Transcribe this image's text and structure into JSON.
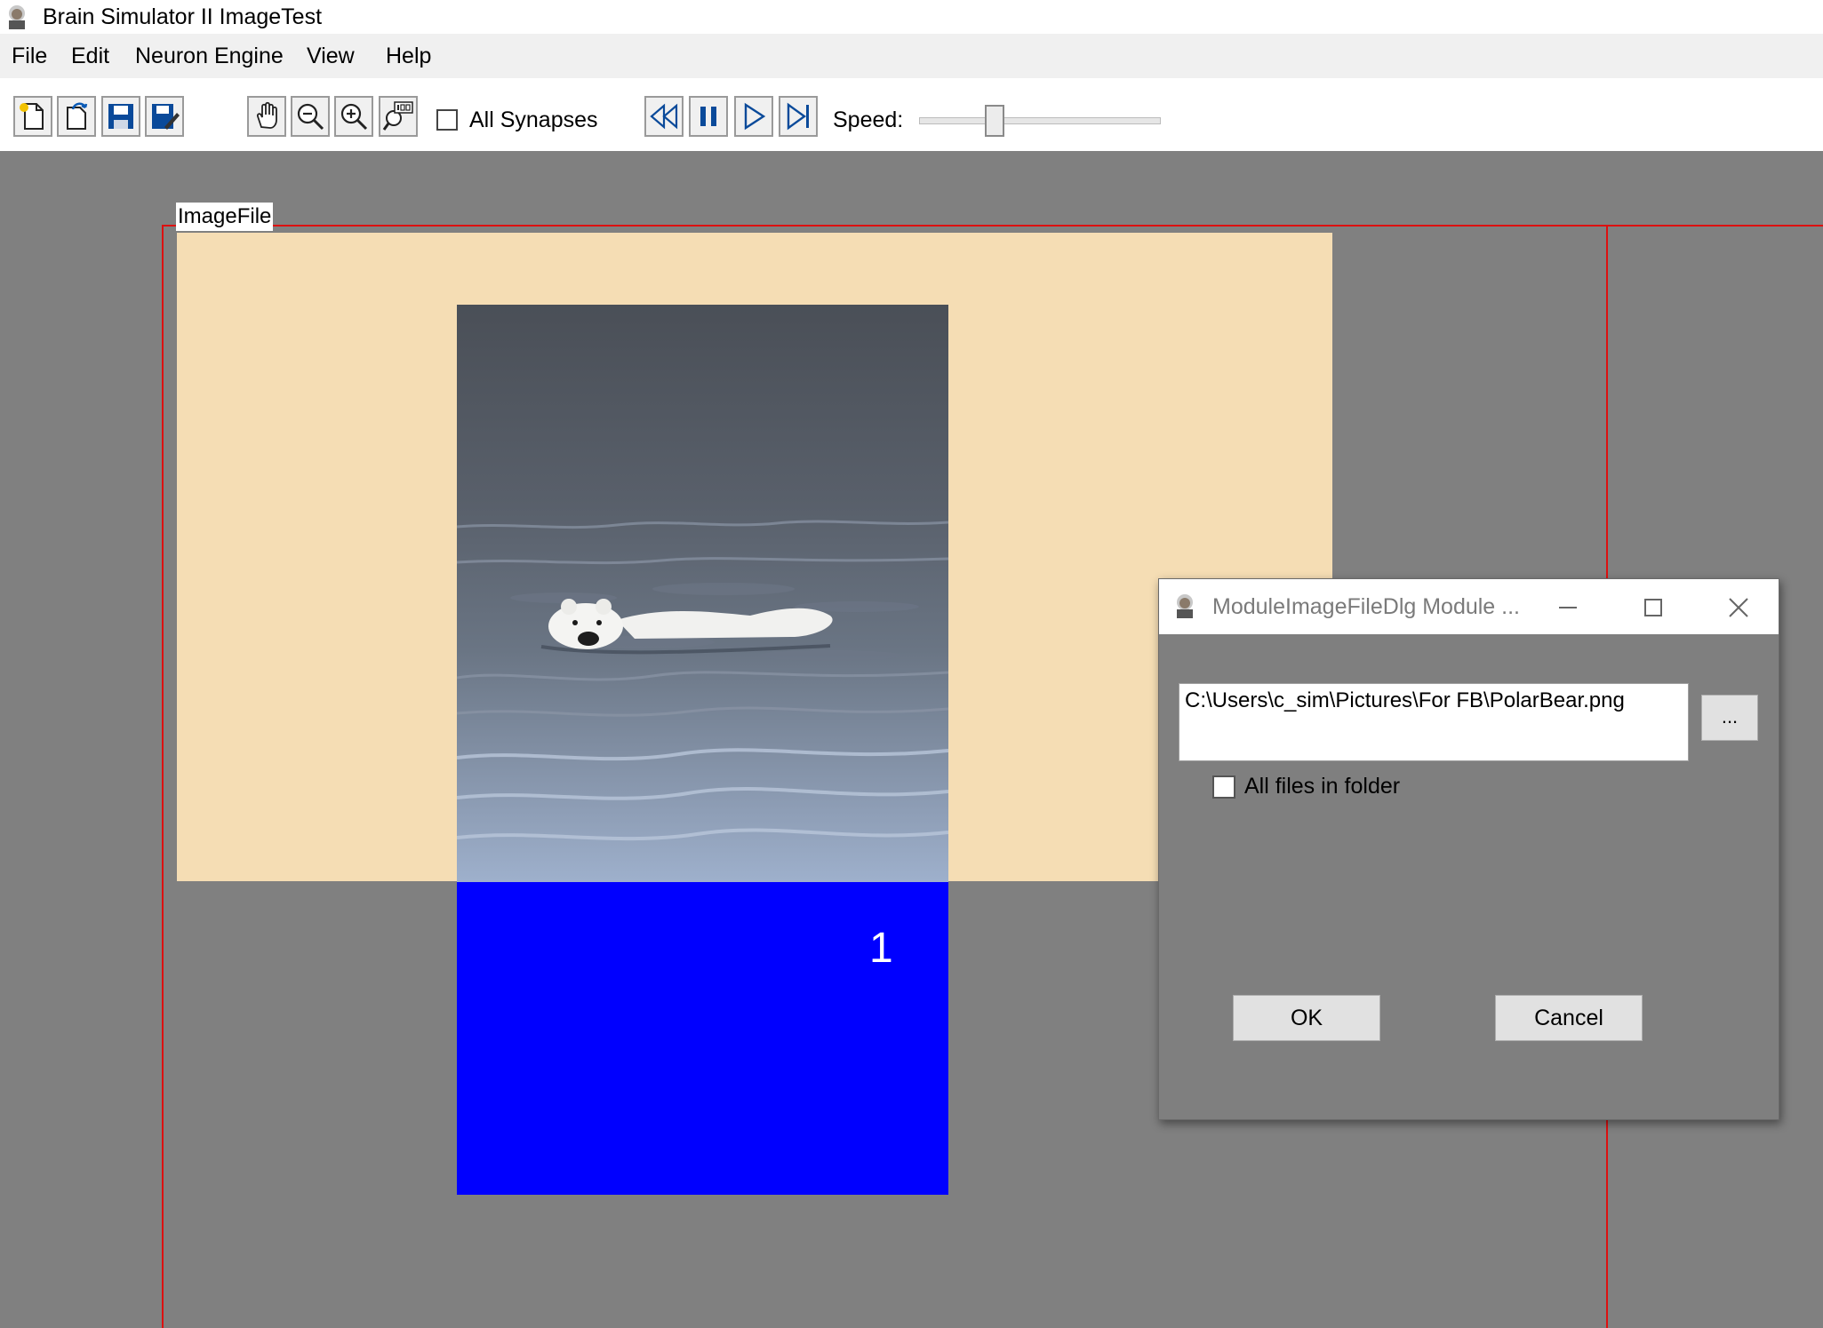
{
  "window": {
    "title": "Brain Simulator II ImageTest",
    "icon": "einstein-app-icon"
  },
  "menu": [
    {
      "label": "File"
    },
    {
      "label": "Edit"
    },
    {
      "label": "Neuron Engine"
    },
    {
      "label": "View"
    },
    {
      "label": "Help"
    }
  ],
  "toolbar": {
    "file_buttons": [
      "new-file-icon",
      "open-file-icon",
      "save-icon",
      "save-as-icon"
    ],
    "view_buttons": [
      "pan-hand-icon",
      "zoom-out-icon",
      "zoom-in-icon",
      "zoom-100-icon"
    ],
    "all_synapses_label": "All Synapses",
    "all_synapses_checked": false,
    "playback_buttons": [
      "rewind-icon",
      "pause-icon",
      "play-icon",
      "step-forward-icon"
    ],
    "speed_label": "Speed:",
    "speed_value_fraction": 0.3
  },
  "canvas": {
    "module_label": "ImageFile",
    "module_color": "#f5ddb4",
    "grid_line_color": "#dd1010",
    "blue_block_color": "#0000ff",
    "blue_block_number": "1"
  },
  "dialog": {
    "title": "ModuleImageFileDlg Module ...",
    "icon": "einstein-app-icon",
    "path_value": "C:\\Users\\c_sim\\Pictures\\For FB\\PolarBear.png",
    "browse_label": "...",
    "all_files_label": "All files in folder",
    "all_files_checked": false,
    "ok_label": "OK",
    "cancel_label": "Cancel"
  }
}
